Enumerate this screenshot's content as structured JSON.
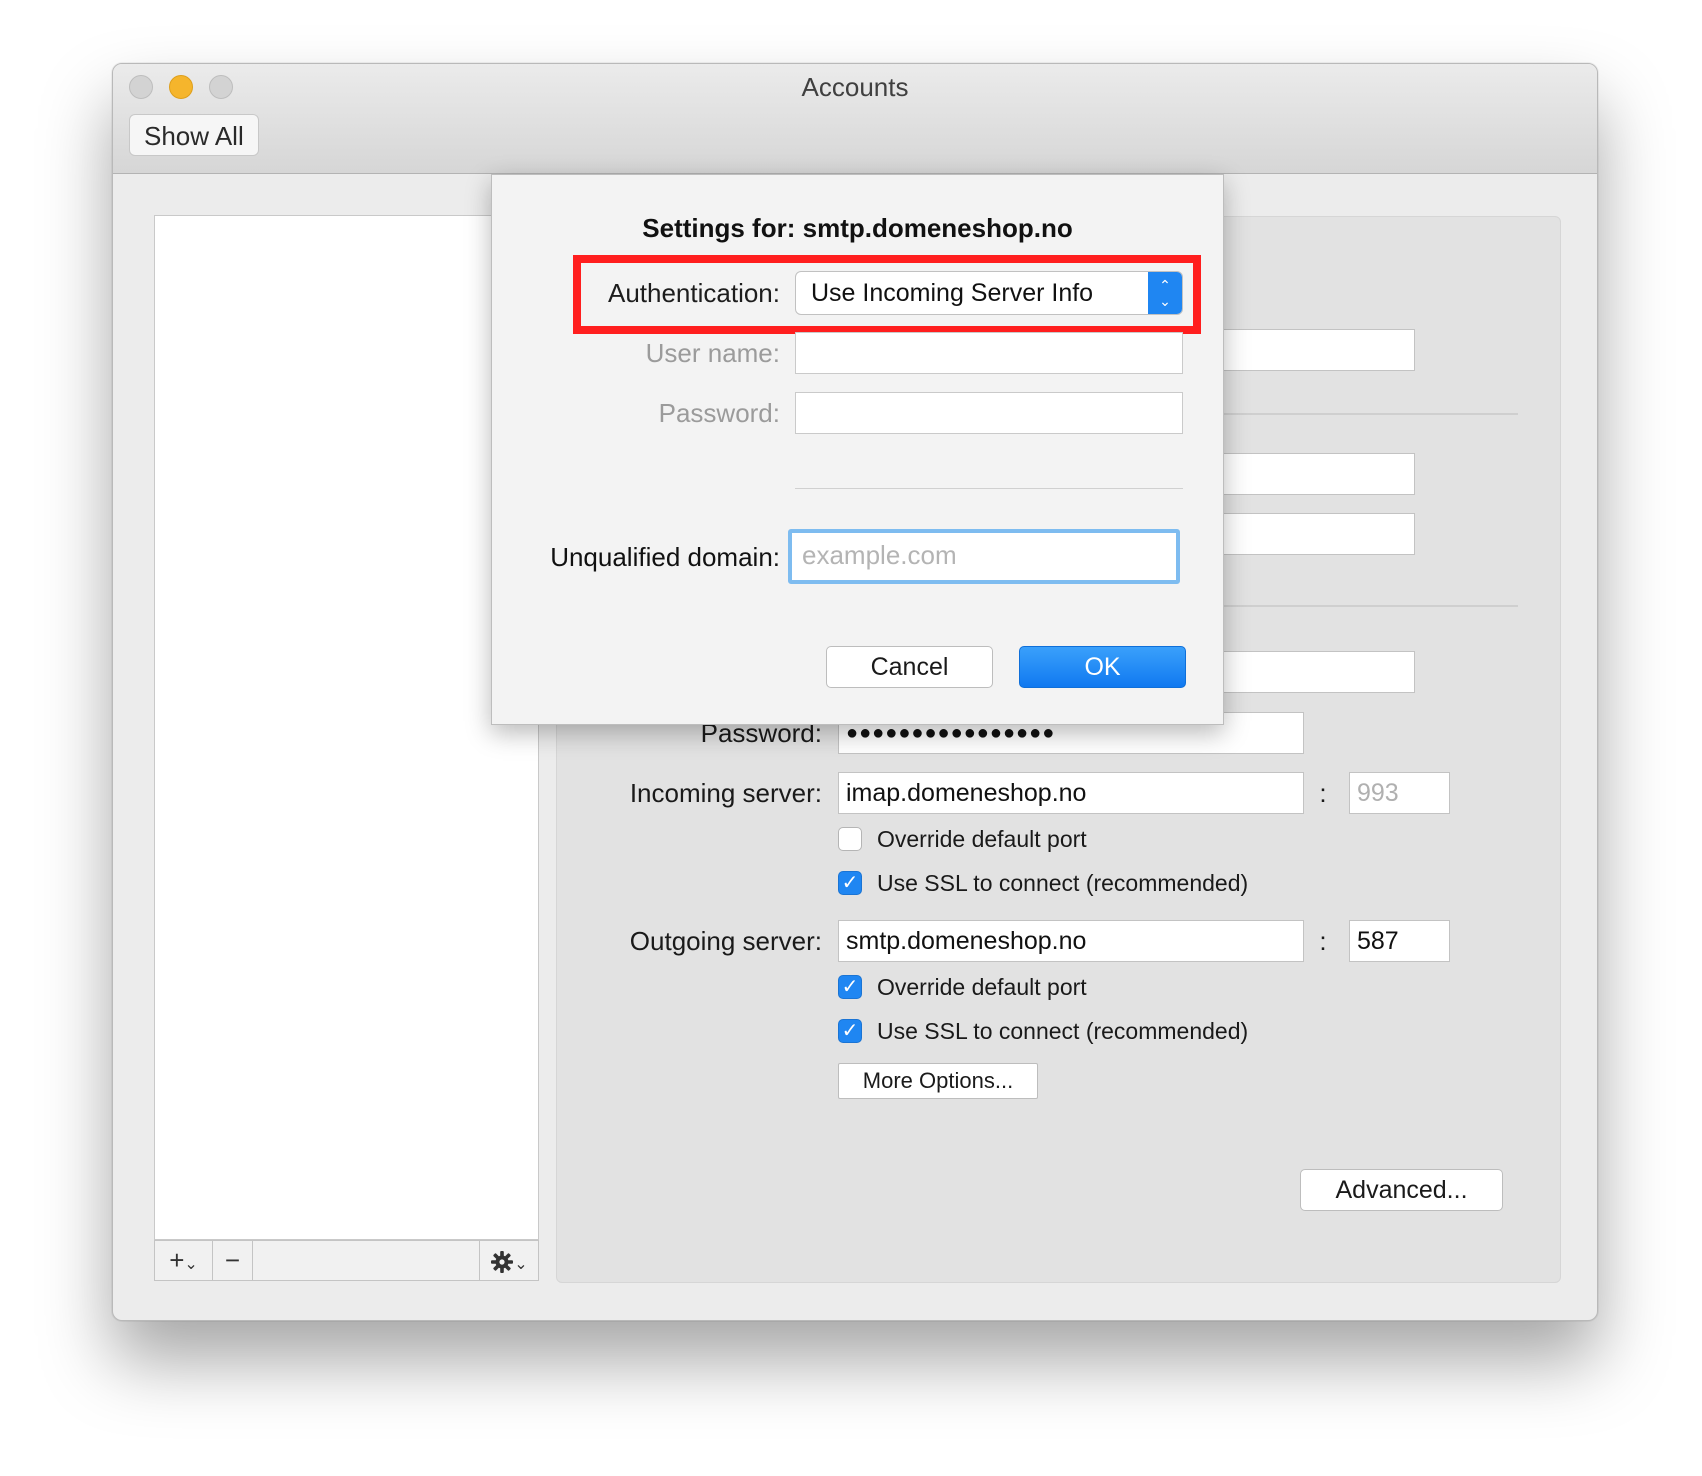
{
  "window": {
    "title": "Accounts",
    "show_all_label": "Show All"
  },
  "list_toolbar": {
    "add_label": "+",
    "add_menu_chevron": "chevron-down",
    "remove_label": "−",
    "actions_icon": "gear-icon",
    "actions_chevron": "chevron-down"
  },
  "detail": {
    "password_label": "Password:",
    "password_value": "●●●●●●●●●●●●●●●●",
    "incoming_label": "Incoming server:",
    "incoming_value": "imap.domeneshop.no",
    "incoming_port_sep": ":",
    "incoming_port_placeholder": "993",
    "incoming_override_label": "Override default port",
    "incoming_override_checked": false,
    "incoming_ssl_label": "Use SSL to connect (recommended)",
    "incoming_ssl_checked": true,
    "outgoing_label": "Outgoing server:",
    "outgoing_value": "smtp.domeneshop.no",
    "outgoing_port_sep": ":",
    "outgoing_port_value": "587",
    "outgoing_override_label": "Override default port",
    "outgoing_override_checked": true,
    "outgoing_ssl_label": "Use SSL to connect (recommended)",
    "outgoing_ssl_checked": true,
    "more_options_label": "More Options...",
    "advanced_label": "Advanced..."
  },
  "sheet": {
    "settings_for_label": "Settings for:",
    "settings_for_value": "smtp.domeneshop.no",
    "authentication_label": "Authentication:",
    "authentication_value": "Use Incoming Server Info",
    "username_label": "User name:",
    "password_label": "Password:",
    "unqualified_domain_label": "Unqualified domain:",
    "unqualified_domain_placeholder": "example.com",
    "cancel_label": "Cancel",
    "ok_label": "OK"
  },
  "colors": {
    "accent": "#1f86f2",
    "highlight_border": "#ff1e1e",
    "focus_ring": "#7ebcf0"
  }
}
